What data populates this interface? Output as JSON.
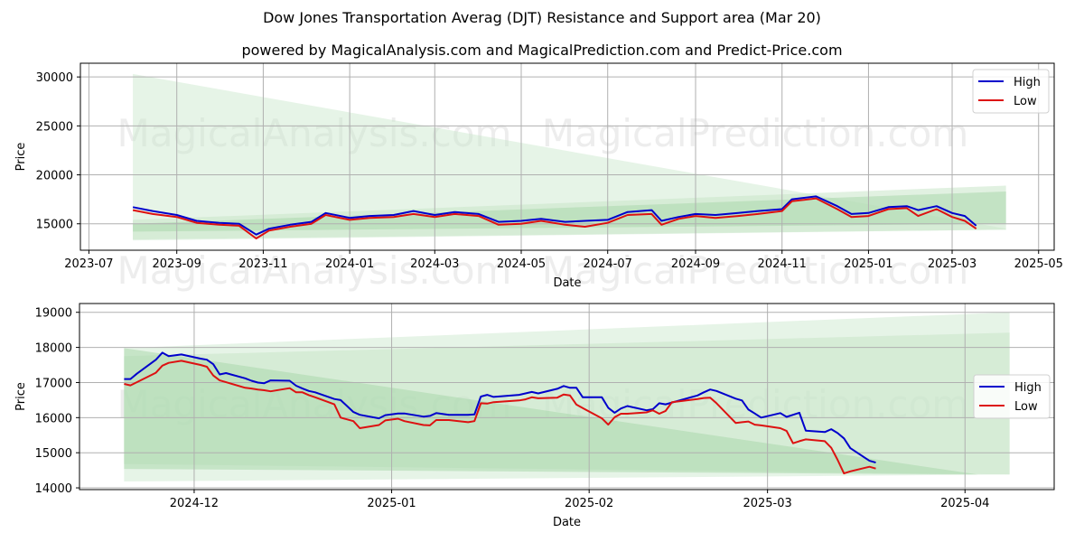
{
  "header": {
    "title": "Dow Jones Transportation Averag (DJT) Resistance and Support area (Mar 20)",
    "subtitle": "powered by MagicalAnalysis.com and MagicalPrediction.com and Predict-Price.com"
  },
  "watermarks": [
    "MagicalAnalysis.com",
    "MagicalPrediction.com"
  ],
  "colors": {
    "high": "#0000cc",
    "low": "#dd1111",
    "band_light": "#c8e6c9",
    "band_dark": "#a5d6a7"
  },
  "chart_data": [
    {
      "type": "line",
      "title": "",
      "xlabel": "Date",
      "ylabel": "Price",
      "xlim": [
        "2023-06-25",
        "2025-05-12"
      ],
      "ylim": [
        12300,
        31400
      ],
      "x_ticks": [
        "2023-07",
        "2023-09",
        "2023-11",
        "2024-01",
        "2024-03",
        "2024-05",
        "2024-07",
        "2024-09",
        "2024-11",
        "2025-01",
        "2025-03",
        "2025-05"
      ],
      "y_ticks": [
        15000,
        20000,
        25000,
        30000
      ],
      "grid": true,
      "legend": {
        "position": "top-right",
        "entries": [
          "High",
          "Low"
        ]
      },
      "bands": [
        {
          "name": "resistance-support-wide",
          "x_start": "2023-08-01",
          "x_end": "2025-04-08",
          "upper_start": 30300,
          "upper_end": 14500,
          "lower_start": 13300,
          "lower_end": 14400
        },
        {
          "name": "resistance-support-narrow",
          "x_start": "2023-08-01",
          "x_end": "2025-04-08",
          "upper_start": 15400,
          "upper_end": 18900,
          "lower_start": 13400,
          "lower_end": 14400
        },
        {
          "name": "resistance-support-mid",
          "x_start": "2023-08-01",
          "x_end": "2025-04-08",
          "upper_start": 15000,
          "upper_end": 18300,
          "lower_start": 14200,
          "lower_end": 15000
        }
      ],
      "x": [
        "2023-08-01",
        "2023-08-15",
        "2023-09-01",
        "2023-09-15",
        "2023-10-01",
        "2023-10-15",
        "2023-10-27",
        "2023-11-05",
        "2023-11-20",
        "2023-12-05",
        "2023-12-15",
        "2024-01-01",
        "2024-01-15",
        "2024-02-01",
        "2024-02-15",
        "2024-03-01",
        "2024-03-15",
        "2024-04-01",
        "2024-04-15",
        "2024-05-01",
        "2024-05-15",
        "2024-06-01",
        "2024-06-15",
        "2024-07-01",
        "2024-07-15",
        "2024-08-01",
        "2024-08-08",
        "2024-08-20",
        "2024-09-01",
        "2024-09-15",
        "2024-10-01",
        "2024-10-15",
        "2024-11-01",
        "2024-11-08",
        "2024-11-25",
        "2024-12-10",
        "2024-12-20",
        "2025-01-01",
        "2025-01-15",
        "2025-01-28",
        "2025-02-05",
        "2025-02-18",
        "2025-03-01",
        "2025-03-10",
        "2025-03-18"
      ],
      "series": [
        {
          "name": "High",
          "values": [
            16700,
            16300,
            15900,
            15300,
            15100,
            15000,
            13900,
            14500,
            14900,
            15200,
            16100,
            15600,
            15800,
            15900,
            16300,
            15900,
            16200,
            16000,
            15200,
            15300,
            15500,
            15200,
            15300,
            15400,
            16200,
            16400,
            15300,
            15700,
            16000,
            15900,
            16100,
            16300,
            16500,
            17500,
            17800,
            16800,
            16000,
            16100,
            16700,
            16800,
            16400,
            16800,
            16100,
            15800,
            14800
          ]
        },
        {
          "name": "Low",
          "values": [
            16400,
            16000,
            15700,
            15100,
            14900,
            14800,
            13500,
            14300,
            14700,
            15000,
            15900,
            15400,
            15600,
            15700,
            16000,
            15700,
            16000,
            15800,
            14900,
            15000,
            15300,
            14900,
            14700,
            15100,
            15900,
            16000,
            14900,
            15500,
            15800,
            15600,
            15800,
            16000,
            16300,
            17300,
            17600,
            16500,
            15700,
            15800,
            16500,
            16600,
            15800,
            16500,
            15700,
            15300,
            14500
          ]
        }
      ]
    },
    {
      "type": "line",
      "title": "",
      "xlabel": "Date",
      "ylabel": "Price",
      "xlim": [
        "2024-11-13",
        "2025-04-15"
      ],
      "ylim": [
        13950,
        19250
      ],
      "x_ticks": [
        "2024-12",
        "2025-01",
        "2025-02",
        "2025-03",
        "2025-04"
      ],
      "y_ticks": [
        14000,
        15000,
        16000,
        17000,
        18000,
        19000
      ],
      "grid": true,
      "legend": {
        "position": "center-right",
        "entries": [
          "High",
          "Low"
        ]
      },
      "bands": [
        {
          "name": "resistance-support-wide",
          "x_start": "2024-11-20",
          "x_end": "2025-04-08",
          "upper_start": 17980,
          "upper_end": 19000,
          "lower_start": 14180,
          "lower_end": 14380
        },
        {
          "name": "resistance-support-mid",
          "x_start": "2024-11-20",
          "x_end": "2025-04-08",
          "upper_start": 17750,
          "upper_end": 18420,
          "lower_start": 14680,
          "lower_end": 14380
        },
        {
          "name": "resistance-support-inner",
          "x_start": "2024-11-20",
          "x_end": "2025-04-03",
          "upper_start": 17980,
          "upper_end": 14380,
          "lower_start": 14540,
          "lower_end": 14380
        }
      ],
      "x": [
        "2024-11-20",
        "2024-11-21",
        "2024-11-22",
        "2024-11-25",
        "2024-11-26",
        "2024-11-27",
        "2024-11-29",
        "2024-12-02",
        "2024-12-03",
        "2024-12-04",
        "2024-12-05",
        "2024-12-06",
        "2024-12-09",
        "2024-12-10",
        "2024-12-11",
        "2024-12-12",
        "2024-12-13",
        "2024-12-16",
        "2024-12-17",
        "2024-12-18",
        "2024-12-19",
        "2024-12-20",
        "2024-12-23",
        "2024-12-24",
        "2024-12-26",
        "2024-12-27",
        "2024-12-30",
        "2024-12-31",
        "2025-01-02",
        "2025-01-03",
        "2025-01-06",
        "2025-01-07",
        "2025-01-08",
        "2025-01-10",
        "2025-01-13",
        "2025-01-14",
        "2025-01-15",
        "2025-01-16",
        "2025-01-17",
        "2025-01-21",
        "2025-01-22",
        "2025-01-23",
        "2025-01-24",
        "2025-01-27",
        "2025-01-28",
        "2025-01-29",
        "2025-01-30",
        "2025-01-31",
        "2025-02-03",
        "2025-02-04",
        "2025-02-05",
        "2025-02-06",
        "2025-02-07",
        "2025-02-10",
        "2025-02-11",
        "2025-02-12",
        "2025-02-13",
        "2025-02-14",
        "2025-02-18",
        "2025-02-19",
        "2025-02-20",
        "2025-02-21",
        "2025-02-24",
        "2025-02-25",
        "2025-02-26",
        "2025-02-27",
        "2025-02-28",
        "2025-03-03",
        "2025-03-04",
        "2025-03-05",
        "2025-03-06",
        "2025-03-07",
        "2025-03-10",
        "2025-03-11",
        "2025-03-12",
        "2025-03-13",
        "2025-03-14",
        "2025-03-17",
        "2025-03-18"
      ],
      "series": [
        {
          "name": "High",
          "values": [
            17100,
            17100,
            17250,
            17650,
            17850,
            17750,
            17800,
            17680,
            17650,
            17520,
            17230,
            17270,
            17120,
            17050,
            17000,
            16980,
            17060,
            17050,
            16910,
            16830,
            16760,
            16720,
            16530,
            16500,
            16160,
            16080,
            15980,
            16070,
            16120,
            16120,
            16030,
            16050,
            16130,
            16080,
            16080,
            16090,
            16600,
            16650,
            16590,
            16650,
            16690,
            16730,
            16690,
            16820,
            16900,
            16850,
            16850,
            16580,
            16580,
            16280,
            16140,
            16260,
            16330,
            16210,
            16240,
            16410,
            16380,
            16430,
            16630,
            16720,
            16800,
            16760,
            16540,
            16490,
            16230,
            16120,
            16000,
            16130,
            16020,
            16080,
            16140,
            15630,
            15590,
            15670,
            15560,
            15410,
            15130,
            14770,
            14720
          ]
        },
        {
          "name": "Low",
          "values": [
            16960,
            16920,
            17010,
            17280,
            17480,
            17560,
            17620,
            17500,
            17450,
            17200,
            17060,
            17010,
            16850,
            16830,
            16800,
            16780,
            16750,
            16840,
            16720,
            16720,
            16640,
            16580,
            16380,
            16000,
            15900,
            15700,
            15790,
            15920,
            15970,
            15900,
            15790,
            15780,
            15930,
            15930,
            15870,
            15900,
            16410,
            16400,
            16440,
            16490,
            16520,
            16580,
            16550,
            16570,
            16660,
            16630,
            16370,
            16270,
            15980,
            15800,
            16010,
            16110,
            16110,
            16150,
            16210,
            16110,
            16190,
            16440,
            16530,
            16560,
            16570,
            16410,
            15850,
            15870,
            15890,
            15800,
            15780,
            15700,
            15620,
            15270,
            15330,
            15380,
            15330,
            15140,
            14800,
            14410,
            14470,
            14600,
            14550
          ]
        }
      ]
    }
  ]
}
